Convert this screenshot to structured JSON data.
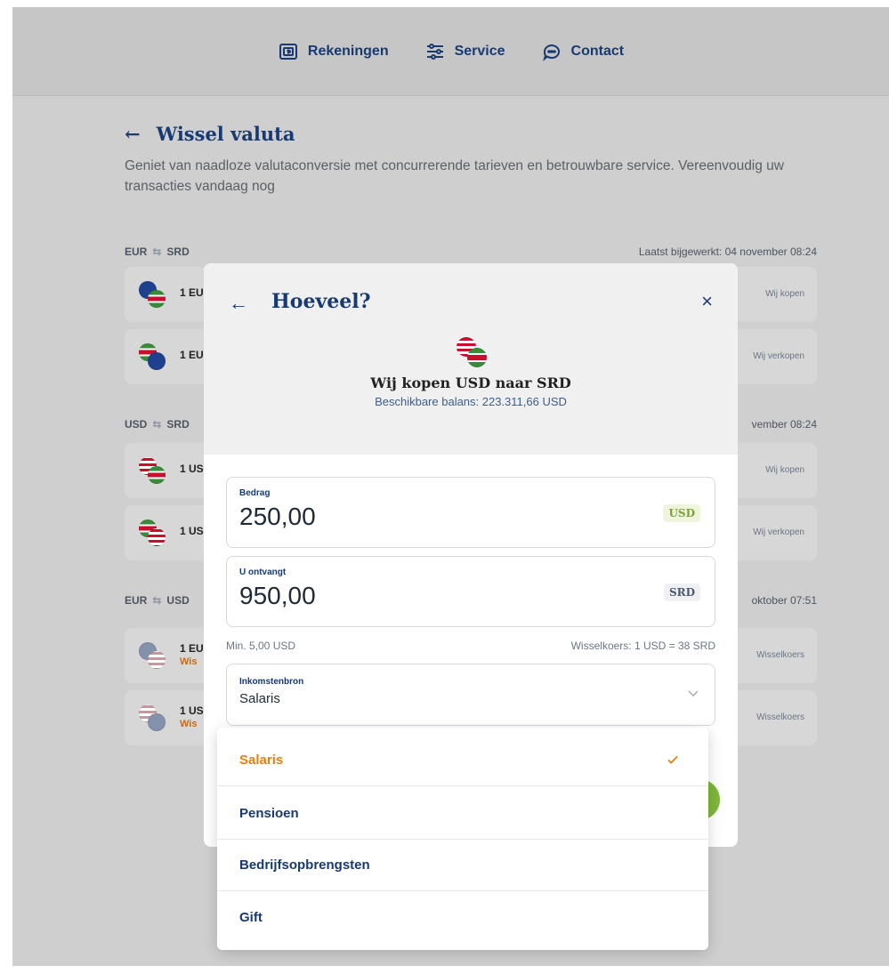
{
  "nav": {
    "items": [
      {
        "label": "Rekeningen",
        "icon": "wallet-icon"
      },
      {
        "label": "Service",
        "icon": "sliders-icon"
      },
      {
        "label": "Contact",
        "icon": "chat-icon"
      }
    ]
  },
  "page": {
    "back_arrow": "←",
    "title": "Wissel valuta",
    "description": "Geniet van naadloze valutaconversie met concurrerende tarieven en betrouwbare service. Vereenvoudig uw transacties vandaag nog"
  },
  "rate_groups": [
    {
      "pair": "EUR",
      "pair_to": "SRD",
      "updated": "Laatst bijgewerkt: 04 november 08:24",
      "rows": [
        {
          "label": "1 EU",
          "action": "Wij kopen"
        },
        {
          "label": "1 EU",
          "action": "Wij verkopen"
        }
      ]
    },
    {
      "pair": "USD",
      "pair_to": "SRD",
      "updated": "vember 08:24",
      "rows": [
        {
          "label": "1 US",
          "action": "Wij kopen"
        },
        {
          "label": "1 US",
          "action": "Wij verkopen"
        }
      ]
    },
    {
      "pair": "EUR",
      "pair_to": "USD",
      "updated": "oktober 07:51",
      "rows": [
        {
          "label": "1 EU",
          "sub": "Wis",
          "action": "Wisselkoers"
        },
        {
          "label": "1 US",
          "sub": "Wis",
          "action": "Wisselkoers"
        }
      ]
    }
  ],
  "modal": {
    "back": "←",
    "title": "Hoeveel?",
    "close": "×",
    "subtitle": "Wij kopen USD naar SRD",
    "balance": "Beschikbare balans: 223.311,66 USD",
    "amount": {
      "label": "Bedrag",
      "value": "250,00",
      "currency": "USD"
    },
    "receive": {
      "label": "U ontvangt",
      "value": "950,00",
      "currency": "SRD"
    },
    "min": "Min. 5,00 USD",
    "rate": "Wisselkoers: 1 USD = 38 SRD",
    "source": {
      "label": "Inkomstenbron",
      "value": "Salaris"
    }
  },
  "dropdown": {
    "options": [
      "Salaris",
      "Pensioen",
      "Bedrijfsopbrengsten",
      "Gift"
    ],
    "selected": "Salaris"
  },
  "colors": {
    "brand_blue": "#173a72",
    "accent_orange": "#e67e12",
    "accent_green": "#7fb73b"
  }
}
